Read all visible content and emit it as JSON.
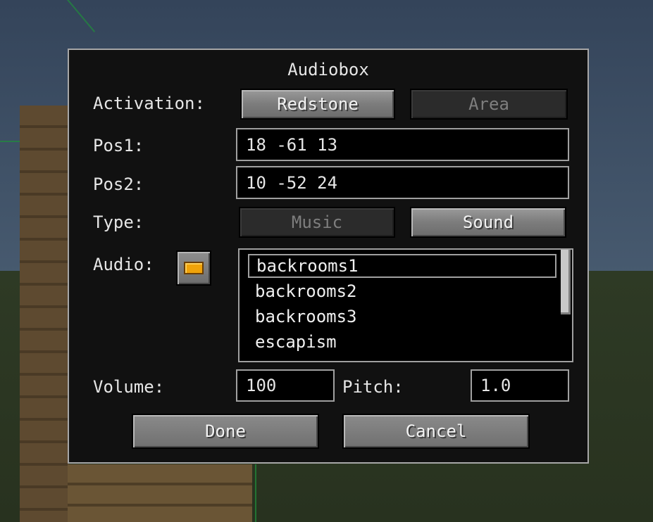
{
  "dialog": {
    "title": "Audiobox",
    "activation": {
      "label": "Activation:",
      "options": [
        "Redstone",
        "Area"
      ],
      "selected": "Redstone"
    },
    "pos1": {
      "label": "Pos1:",
      "value": "18 -61 13"
    },
    "pos2": {
      "label": "Pos2:",
      "value": "10 -52 24"
    },
    "type": {
      "label": "Type:",
      "options": [
        "Music",
        "Sound"
      ],
      "selected": "Sound"
    },
    "audio": {
      "label": "Audio:",
      "icon": "music-disc-icon",
      "items": [
        "backrooms1",
        "backrooms2",
        "backrooms3",
        "escapism"
      ],
      "selected": "backrooms1"
    },
    "volume": {
      "label": "Volume:",
      "value": "100"
    },
    "pitch": {
      "label": "Pitch:",
      "value": "1.0"
    },
    "done_label": "Done",
    "cancel_label": "Cancel"
  },
  "colors": {
    "accent": "#f0a30a",
    "panel": "#111111",
    "border": "#a7a7a7"
  }
}
